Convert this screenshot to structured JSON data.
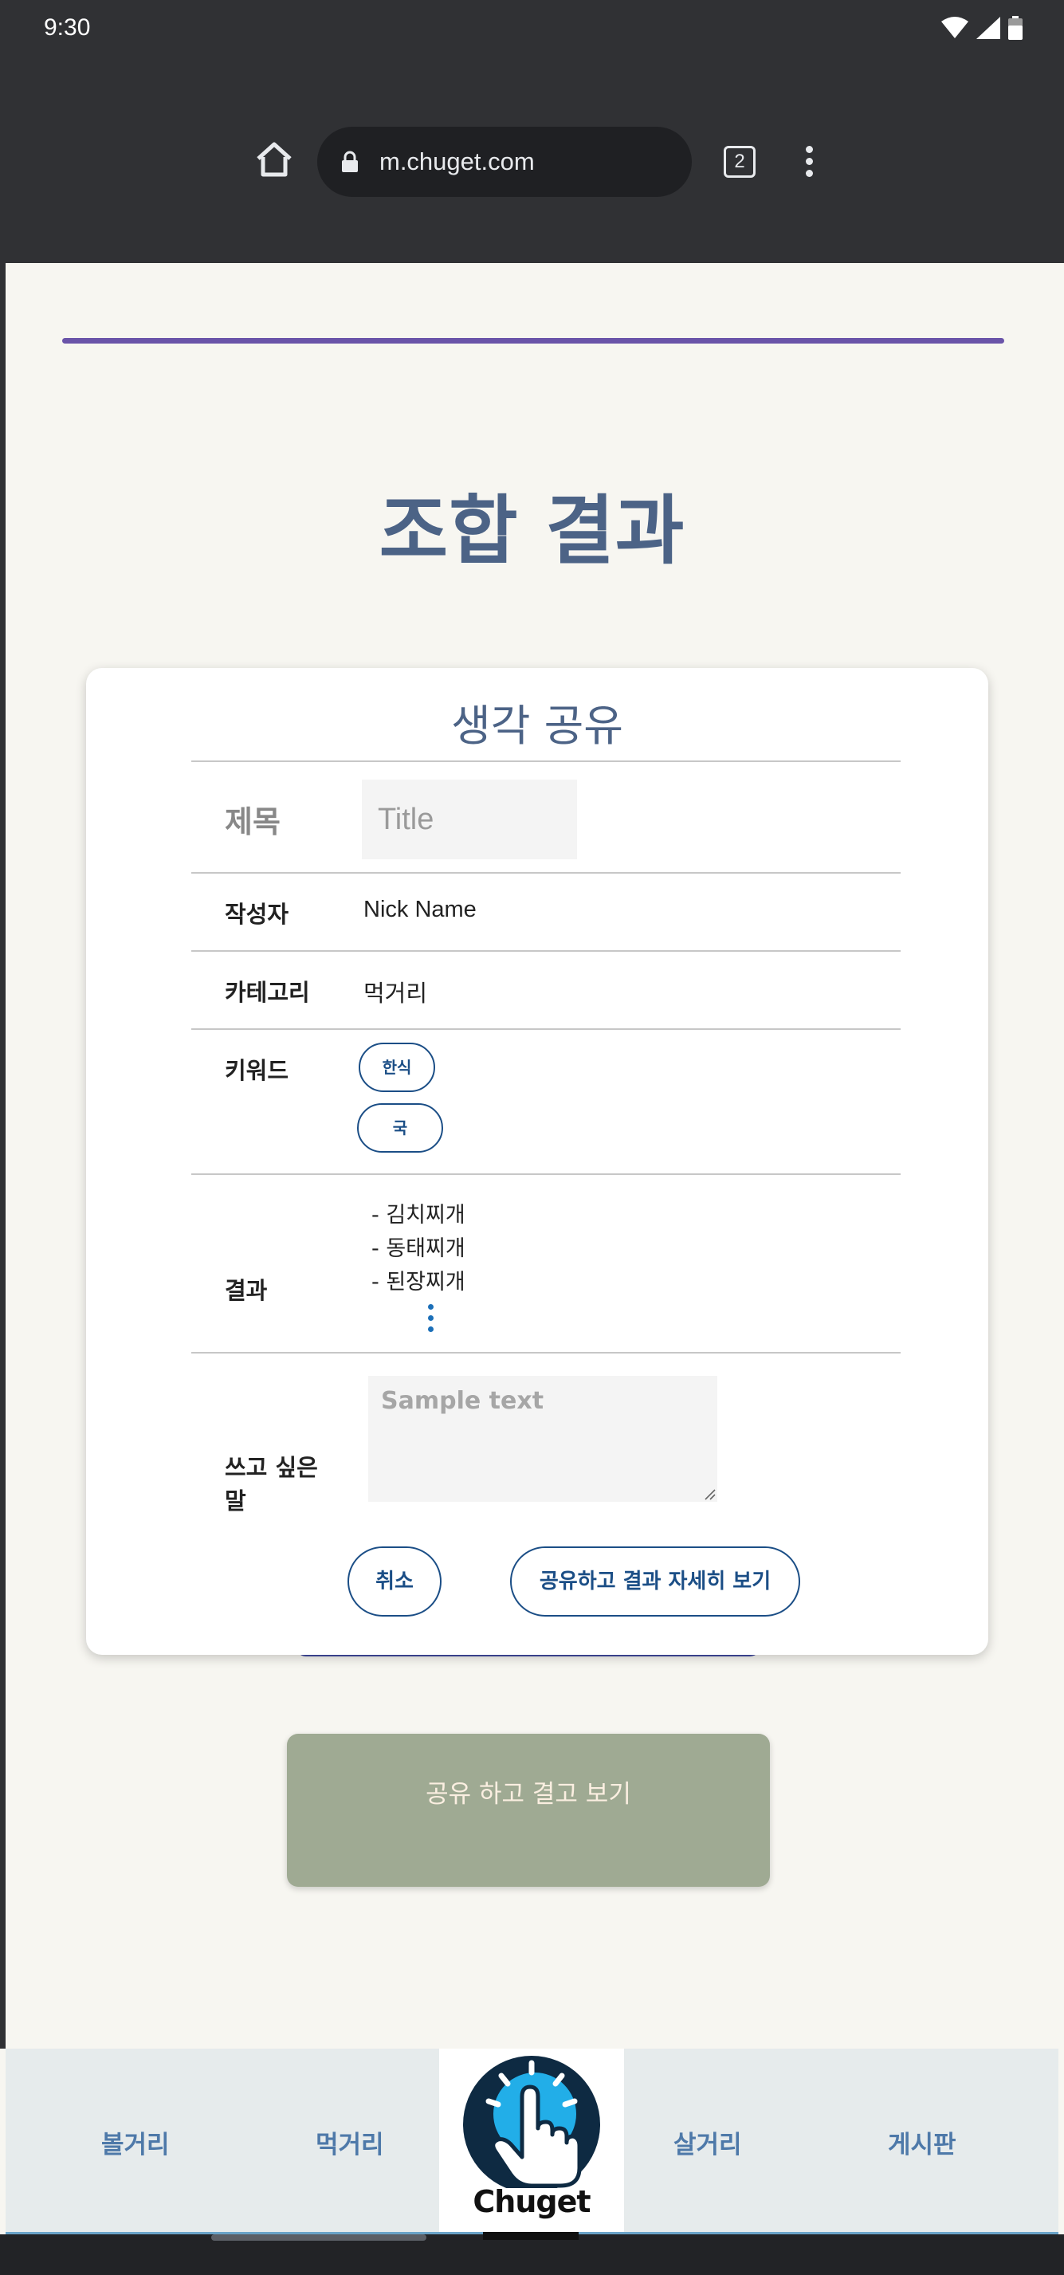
{
  "status_bar": {
    "time": "9:30"
  },
  "browser": {
    "url": "m.chuget.com",
    "tab_count": "2"
  },
  "page": {
    "title": "조합 결과"
  },
  "card": {
    "title": "생각 공유",
    "title_label": "제목",
    "title_placeholder": "Title",
    "author_label": "작성자",
    "author_value": "Nick Name",
    "category_label": "카테고리",
    "category_value": "먹거리",
    "keyword_label": "키워드",
    "keywords": [
      "한식",
      "국"
    ],
    "result_label": "결과",
    "results": [
      "- 김치찌개",
      "- 동태찌개",
      "- 된장찌개"
    ],
    "message_label": "쓰고 싶은 말",
    "message_placeholder": "Sample text",
    "cancel_label": "취소",
    "share_detail_label": "공유하고 결과 자세히 보기"
  },
  "share_button_label": "공유 하고 결고 보기",
  "bottom_nav": {
    "items": [
      "볼거리",
      "먹거리",
      "살거리",
      "게시판"
    ],
    "logo_text": "Chuget"
  },
  "colors": {
    "accent": "#4c6386",
    "button_border": "#1b4e86",
    "progress": "#6a54a9",
    "share_button": "#9faa93",
    "nav_text": "#4e79a9"
  }
}
